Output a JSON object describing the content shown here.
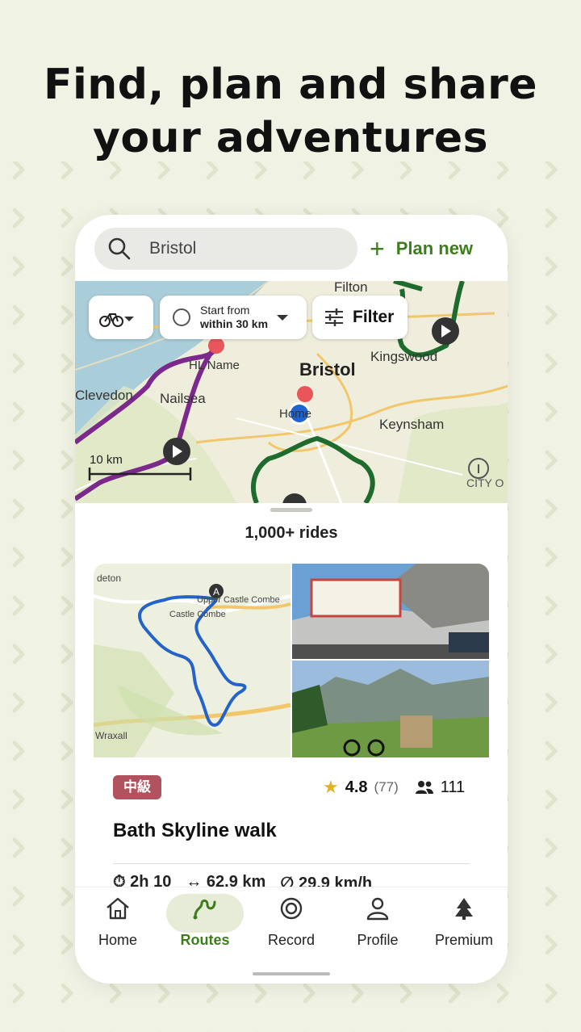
{
  "headline": {
    "line1": "Find, plan and share",
    "line2": "your adventures"
  },
  "search": {
    "value": "Bristol",
    "icon": "search-icon"
  },
  "plan_new": {
    "label": "Plan new",
    "icon": "plus-icon"
  },
  "filters": {
    "activity_icon": "bike-icon",
    "start_from_label": "Start from",
    "start_from_value": "within 30 km",
    "filter_label": "Filter"
  },
  "map": {
    "places": {
      "filton": "Filton",
      "kingswood": "Kingswood",
      "bristol": "Bristol",
      "hl_name": "HL Name",
      "clevedon": "Clevedon",
      "nailsea": "Nailsea",
      "home": "Home",
      "keynsham": "Keynsham",
      "city": "CITY O",
      "card_map_deton": "deton",
      "card_map_castle_combe_upper": "Upper Castle Combe",
      "card_map_castle_combe": "Castle Combe",
      "card_map_wraxall": "Wraxall",
      "card_map_start_marker": "A"
    },
    "scale_label": "10 km"
  },
  "results": {
    "count_label": "1,000+ rides"
  },
  "route_card": {
    "difficulty_badge": "中級",
    "rating": "4.8",
    "rating_count": "(77)",
    "people_count": "111",
    "title": "Bath Skyline walk",
    "duration": "2h 10",
    "distance": "62.9 km",
    "speed": "29.9 km/h"
  },
  "nav": {
    "items": [
      {
        "label": "Home",
        "icon": "home-icon"
      },
      {
        "label": "Routes",
        "icon": "routes-icon"
      },
      {
        "label": "Record",
        "icon": "record-icon"
      },
      {
        "label": "Profile",
        "icon": "profile-icon"
      },
      {
        "label": "Premium",
        "icon": "premium-icon"
      }
    ],
    "active": "Routes"
  },
  "colors": {
    "accent": "#3e7d1e",
    "background": "#f0f2e4",
    "badge": "#b0535e",
    "route_purple": "#7b2a8c",
    "route_green": "#1f6b2e",
    "route_blue": "#2563c9"
  }
}
